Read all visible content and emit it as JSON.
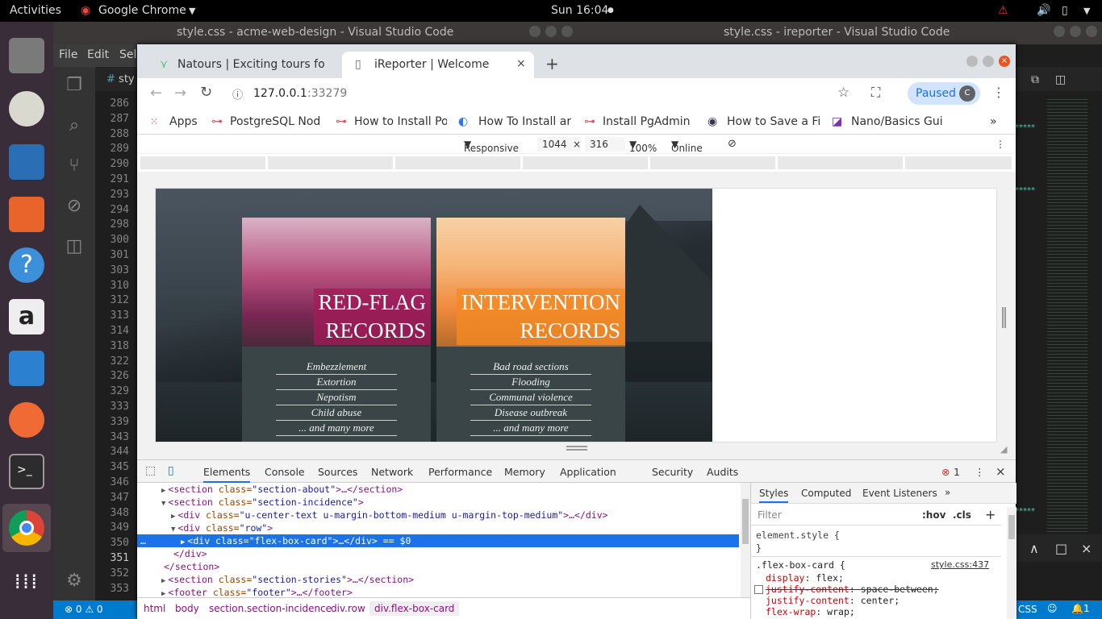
{
  "topbar": {
    "activities": "Activities",
    "app": "Google Chrome",
    "clock": "Sun 16:04"
  },
  "vscode": {
    "title_left": "style.css - acme-web-design - Visual Studio Code",
    "title_right": "style.css - ireporter - Visual Studio Code",
    "menu": [
      "File",
      "Edit",
      "Sel"
    ],
    "tab_label": "sty",
    "line_numbers": [
      "286",
      "287",
      "288",
      "289",
      "290",
      "291",
      "293",
      "294",
      "298",
      "300",
      "301",
      "303",
      "310",
      "312",
      "313",
      "314",
      "318",
      "322",
      "326",
      "329",
      "333",
      "339",
      "343",
      "344",
      "345",
      "346",
      "347",
      "348",
      "349",
      "350",
      "351",
      "352",
      "353"
    ],
    "status": {
      "errors": "0",
      "warnings": "0",
      "language": "CSS",
      "notifications": "1"
    }
  },
  "chrome": {
    "tabs": [
      {
        "label": "Natours | Exciting tours fo",
        "active": false
      },
      {
        "label": "iReporter | Welcome",
        "active": true
      }
    ],
    "new_tab": "+",
    "url_host": "127.0.0.1",
    "url_port": ":33279",
    "paused_label": "Paused",
    "profile_initial": "C",
    "bookmarks": [
      "Apps",
      "PostgreSQL Nod",
      "How to Install Po",
      "How To Install ar",
      "Install PgAdmin",
      "How to Save a Fi",
      "Nano/Basics Gui"
    ],
    "bookmarks_more": "»"
  },
  "device_toolbar": {
    "mode": "Responsive",
    "width": "1044",
    "times": "×",
    "height": "316",
    "zoom": "100%",
    "network": "Online"
  },
  "page": {
    "cards": [
      {
        "heading_line1": "RED-FLAG",
        "heading_line2": "RECORDS",
        "items": [
          "Embezzlement",
          "Extortion",
          "Nepotism",
          "Child abuse",
          "... and many more"
        ],
        "accent": "#a4195a"
      },
      {
        "heading_line1": "INTERVENTION",
        "heading_line2": "RECORDS",
        "items": [
          "Bad road sections",
          "Flooding",
          "Communal violence",
          "Disease outbreak",
          "... and many more"
        ],
        "accent": "#f28a24"
      }
    ]
  },
  "devtools": {
    "tabs": [
      "Elements",
      "Console",
      "Sources",
      "Network",
      "Performance",
      "Memory",
      "Application",
      "Security",
      "Audits"
    ],
    "active_tab": "Elements",
    "error_count": "1",
    "dom_lines": [
      {
        "indent": 0,
        "arrow": "▶",
        "tag_open": "<section ",
        "attr": "class=",
        "val": "\"section-about\"",
        "rest": ">…</section>"
      },
      {
        "indent": 0,
        "arrow": "▼",
        "tag_open": "<section ",
        "attr": "class=",
        "val": "\"section-incidence\"",
        "rest": ">"
      },
      {
        "indent": 1,
        "arrow": "▶",
        "tag_open": "<div ",
        "attr": "class=",
        "val": "\"u-center-text u-margin-bottom-medium u-margin-top-medium\"",
        "rest": ">…</div>"
      },
      {
        "indent": 1,
        "arrow": "▼",
        "tag_open": "<div ",
        "attr": "class=",
        "val": "\"row\"",
        "rest": ">"
      },
      {
        "indent": 2,
        "arrow": "▶",
        "tag_open": "<div ",
        "attr": "class=",
        "val": "\"flex-box-card\"",
        "rest": ">…</div> == $0"
      },
      {
        "indent": 1,
        "arrow": "",
        "tag_open": "</div>",
        "attr": "",
        "val": "",
        "rest": ""
      },
      {
        "indent": 0,
        "arrow": "",
        "tag_open": "</section>",
        "attr": "",
        "val": "",
        "rest": ""
      },
      {
        "indent": 0,
        "arrow": "▶",
        "tag_open": "<section ",
        "attr": "class=",
        "val": "\"section-stories\"",
        "rest": ">…</section>"
      },
      {
        "indent": 0,
        "arrow": "▶",
        "tag_open": "<footer ",
        "attr": "class=",
        "val": "\"footer\"",
        "rest": ">…</footer>"
      }
    ],
    "breadcrumbs": [
      "html",
      "body",
      "section.section-incidence",
      "div.row",
      "div.flex-box-card"
    ],
    "styles_tabs": [
      "Styles",
      "Computed",
      "Event Listeners",
      "»"
    ],
    "filter_placeholder": "Filter",
    "hov": ":hov",
    "cls": ".cls",
    "element_style": "element.style {",
    "close_brace": "}",
    "rule_selector": ".flex-box-card {",
    "rule_source": "style.css:437",
    "declarations": [
      {
        "prop": "display",
        "value": "flex;",
        "struck": false
      },
      {
        "prop": "justify-content",
        "value": "space-between;",
        "struck": true
      },
      {
        "prop": "justify-content",
        "value": "center;",
        "struck": false
      },
      {
        "prop": "flex-wrap",
        "value": "wrap;",
        "struck": false
      }
    ]
  }
}
